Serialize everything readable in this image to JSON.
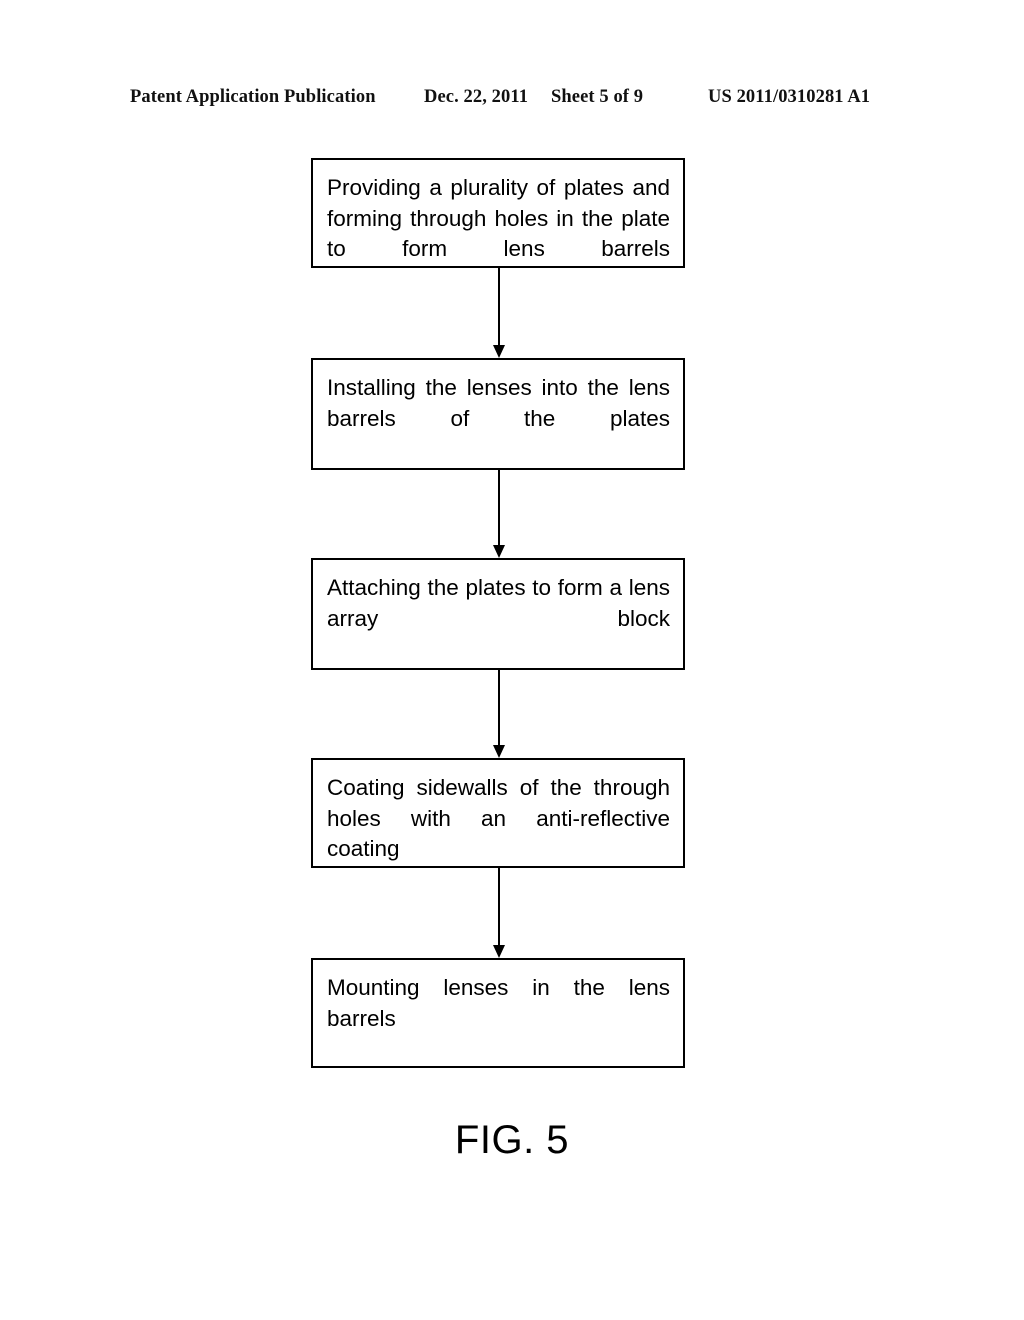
{
  "header": {
    "publication": "Patent Application Publication",
    "date": "Dec. 22, 2011",
    "sheet": "Sheet 5 of 9",
    "patent_number": "US 2011/0310281 A1"
  },
  "figure": {
    "caption": "FIG. 5",
    "type": "flowchart",
    "orientation": "vertical",
    "connector_style": "arrow-down",
    "box_count": 5,
    "steps": [
      {
        "id": "step-1",
        "text": "Providing a plurality of plates and forming through holes in the plate to form lens barrels"
      },
      {
        "id": "step-2",
        "text": "Installing the lenses into the lens barrels of the plates"
      },
      {
        "id": "step-3",
        "text": "Attaching the plates to form a lens array block"
      },
      {
        "id": "step-4",
        "text": "Coating sidewalls of the through holes with an anti-reflective coating"
      },
      {
        "id": "step-5",
        "text": "Mounting lenses in the lens barrels"
      }
    ]
  },
  "colors": {
    "ink": "#000000",
    "paper": "#ffffff"
  }
}
